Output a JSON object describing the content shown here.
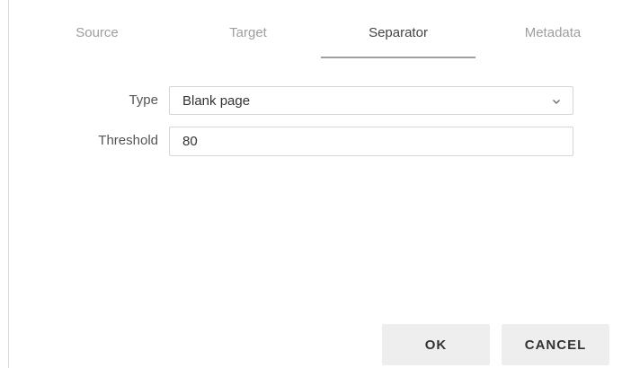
{
  "tabs": [
    {
      "label": "Source"
    },
    {
      "label": "Target"
    },
    {
      "label": "Separator"
    },
    {
      "label": "Metadata"
    }
  ],
  "active_tab": "Separator",
  "form": {
    "type_label": "Type",
    "type_value": "Blank page",
    "threshold_label": "Threshold",
    "threshold_value": "80"
  },
  "buttons": {
    "ok_label": "OK",
    "cancel_label": "CANCEL"
  },
  "colors": {
    "inactive_tab": "#9e9e9e",
    "active_tab": "#444444",
    "button_bg": "#eeeeee"
  },
  "icons": {
    "dropdown": "chevron-down-icon"
  }
}
